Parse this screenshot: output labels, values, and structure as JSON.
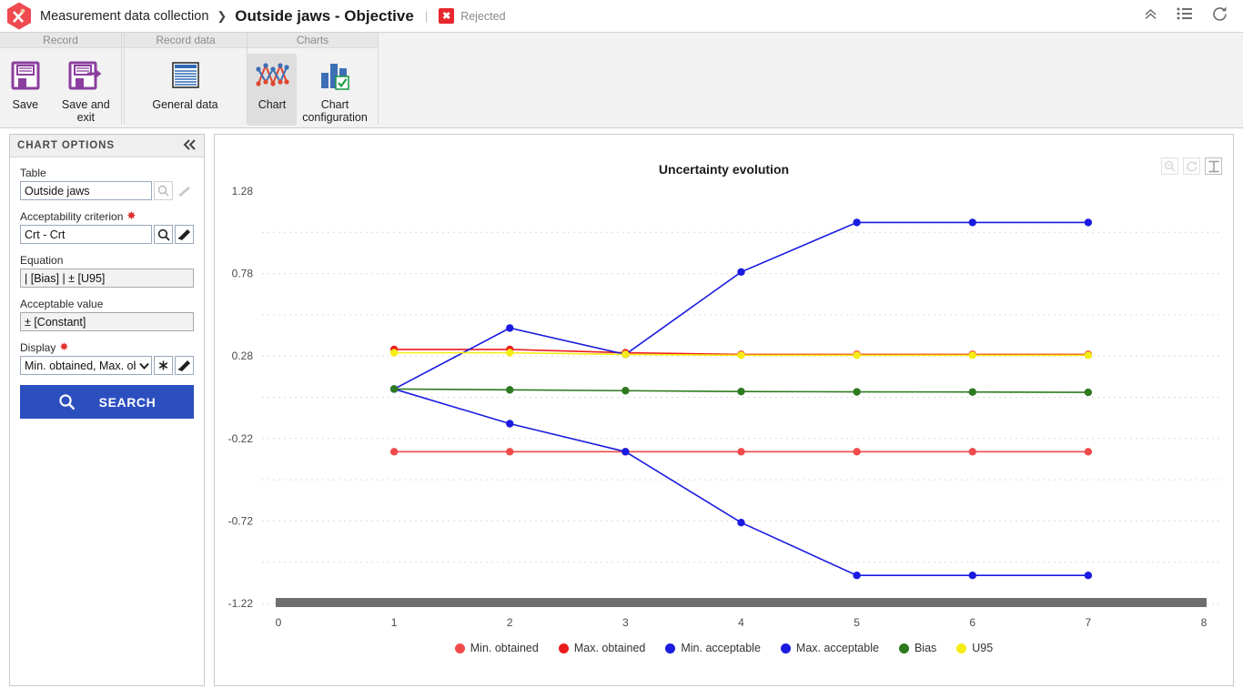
{
  "header": {
    "logo_icon": "app-hexagon-caliper-icon",
    "breadcrumb_root": "Measurement data collection",
    "breadcrumb_separator": "❯",
    "breadcrumb_current": "Outside jaws - Objective",
    "divider": "|",
    "status_mark": "✖",
    "status_text": "Rejected",
    "icons": [
      {
        "name": "collapse-up-icon",
        "glyph": "⌃"
      },
      {
        "name": "list-menu-icon",
        "glyph": "≡"
      },
      {
        "name": "refresh-icon",
        "glyph": "⟳"
      }
    ]
  },
  "ribbon": {
    "groups": [
      {
        "title": "Record",
        "buttons": [
          {
            "label": "Save",
            "icon": "floppy-disk-icon",
            "active": false
          },
          {
            "label": "Save and exit",
            "icon": "floppy-disk-arrow-icon",
            "active": false
          }
        ]
      },
      {
        "title": "Record data",
        "buttons": [
          {
            "label": "General data",
            "icon": "document-lines-icon",
            "active": false
          }
        ]
      },
      {
        "title": "Charts",
        "buttons": [
          {
            "label": "Chart",
            "icon": "line-chart-icon",
            "active": true
          },
          {
            "label": "Chart configuration",
            "icon": "bar-chart-check-icon",
            "active": false
          }
        ]
      }
    ]
  },
  "options_panel": {
    "title": "CHART OPTIONS",
    "collapse_icon": "double-chevron-left-icon",
    "fields": {
      "table": {
        "label": "Table",
        "value": "Outside jaws",
        "required": false,
        "buttons": [
          "search-magnifier-icon",
          "eraser-brush-icon"
        ]
      },
      "acceptability_criterion": {
        "label": "Acceptability criterion",
        "value": "Crt - Crt",
        "required": true,
        "required_marker": "✸",
        "buttons": [
          "search-magnifier-icon",
          "eraser-brush-icon"
        ]
      },
      "equation": {
        "label": "Equation",
        "value": "| [Bias] | ± [U95]",
        "required": false,
        "readonly": true
      },
      "acceptable_value": {
        "label": "Acceptable value",
        "value": "± [Constant]",
        "required": false,
        "readonly": true
      },
      "display": {
        "label": "Display",
        "value": "Min. obtained, Max. ob",
        "required": true,
        "required_marker": "✸",
        "buttons": [
          "chevron-down-icon",
          "asterisk-icon",
          "eraser-brush-icon"
        ]
      }
    },
    "search_button": {
      "label": "SEARCH",
      "icon": "search-magnifier-icon"
    }
  },
  "chart_panel": {
    "tools": [
      {
        "name": "zoom-out-icon",
        "selected": false
      },
      {
        "name": "reset-zoom-icon",
        "selected": false
      },
      {
        "name": "range-select-icon",
        "selected": true
      }
    ],
    "scrollbar": {
      "name": "horizontal-range-scrollbar",
      "color": "#6e6e6e"
    }
  },
  "chart_data": {
    "type": "line",
    "title": "Uncertainty evolution",
    "xlabel": "",
    "ylabel": "",
    "x": [
      1,
      2,
      3,
      4,
      5,
      6,
      7
    ],
    "xlim": [
      0,
      8
    ],
    "ylim": [
      -1.22,
      1.28
    ],
    "xticks": [
      0,
      1,
      2,
      3,
      4,
      5,
      6,
      7,
      8
    ],
    "yticks": [
      1.28,
      0.78,
      0.28,
      -0.22,
      -0.72,
      -1.22
    ],
    "grid": true,
    "grid_style": "dotted-horizontal",
    "legend_position": "bottom",
    "series": [
      {
        "name": "Min. obtained",
        "color": "#f04a4a",
        "values": [
          -0.3,
          -0.3,
          -0.3,
          -0.3,
          -0.3,
          -0.3,
          -0.3
        ]
      },
      {
        "name": "Max. obtained",
        "color": "#ec1c1c",
        "values": [
          0.32,
          0.32,
          0.3,
          0.29,
          0.29,
          0.29,
          0.29
        ]
      },
      {
        "name": "Min. acceptable",
        "color": "#1a1ae0",
        "values": [
          0.08,
          -0.13,
          -0.3,
          -0.73,
          -1.05,
          -1.05,
          -1.05
        ]
      },
      {
        "name": "Max. acceptable",
        "color": "#1a1ae0",
        "values": [
          0.08,
          0.45,
          0.29,
          0.79,
          1.09,
          1.09,
          1.09
        ]
      },
      {
        "name": "Bias",
        "color": "#2d7a1f",
        "values": [
          0.08,
          0.075,
          0.07,
          0.065,
          0.063,
          0.062,
          0.06
        ]
      },
      {
        "name": "U95",
        "color": "#f5ec15",
        "values": [
          0.3,
          0.3,
          0.29,
          0.285,
          0.285,
          0.285,
          0.285
        ]
      }
    ]
  },
  "colors": {
    "brand_red": "#ef4a50",
    "accent_blue": "#2c4fc0",
    "ribbon_bg": "#f2f2f2",
    "status_red": "#e8262d"
  }
}
